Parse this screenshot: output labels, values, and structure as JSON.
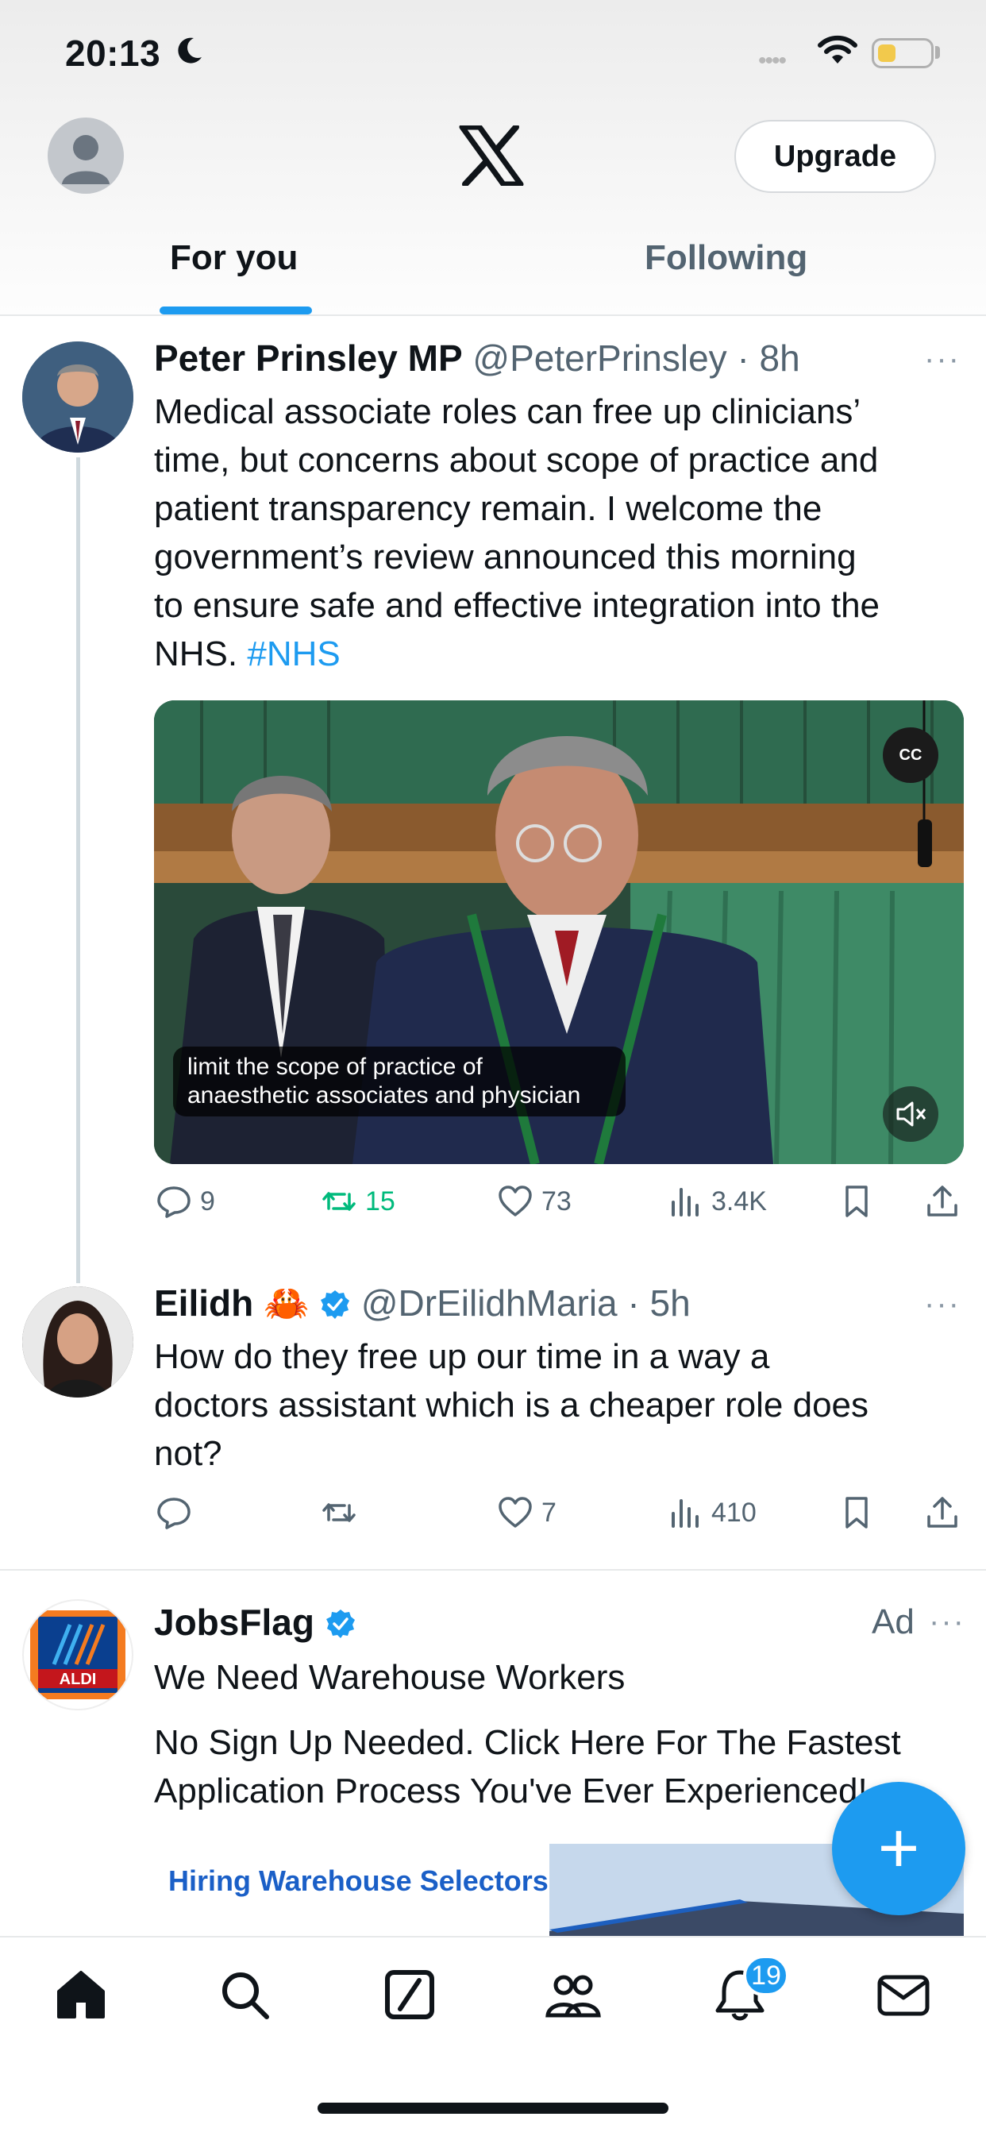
{
  "status_bar": {
    "time": "20:13",
    "signal": "••••"
  },
  "header": {
    "upgrade_label": "Upgrade",
    "tabs": [
      {
        "label": "For you",
        "active": true
      },
      {
        "label": "Following",
        "active": false
      }
    ]
  },
  "tweets": [
    {
      "name": "Peter Prinsley MP",
      "handle": "@PeterPrinsley",
      "time": "· 8h",
      "more": "···",
      "lines": [
        "Medical associate roles can free up clinicians’",
        "time, but concerns about scope of practice and",
        "patient transparency remain. I welcome the",
        "government’s review announced this morning",
        "to ensure safe and effective integration into the"
      ],
      "last_line_text": "NHS. ",
      "hashtag": "#NHS",
      "video": {
        "caption_line1": "limit the scope of practice of",
        "caption_line2": "anaesthetic associates and physician",
        "cc_label": "CC"
      },
      "actions": {
        "replies": "9",
        "reposts": "15",
        "likes": "73",
        "views": "3.4K"
      }
    },
    {
      "name": "Eilidh",
      "emoji": "🦀",
      "handle": "@DrEilidhMaria",
      "time": "· 5h",
      "more": "···",
      "lines": [
        "How do they free up our time in a way a",
        "doctors assistant which is a cheaper role does",
        "not?"
      ],
      "actions": {
        "replies": "",
        "reposts": "",
        "likes": "7",
        "views": "410"
      }
    }
  ],
  "ad": {
    "name": "JobsFlag",
    "label": "Ad",
    "more": "···",
    "logo_text": "ALDI",
    "headline": "We Need Warehouse Workers",
    "lines": [
      "No Sign Up Needed. Click Here For The Fastest",
      "Application Process You've Ever Experienced!"
    ],
    "card_text": "Hiring Warehouse Selectors"
  },
  "fab_label": "+",
  "nav": {
    "notifications_badge": "19"
  },
  "colors": {
    "accent": "#1d9bf0",
    "repost_green": "#00ba7c",
    "text_secondary": "#536471"
  }
}
